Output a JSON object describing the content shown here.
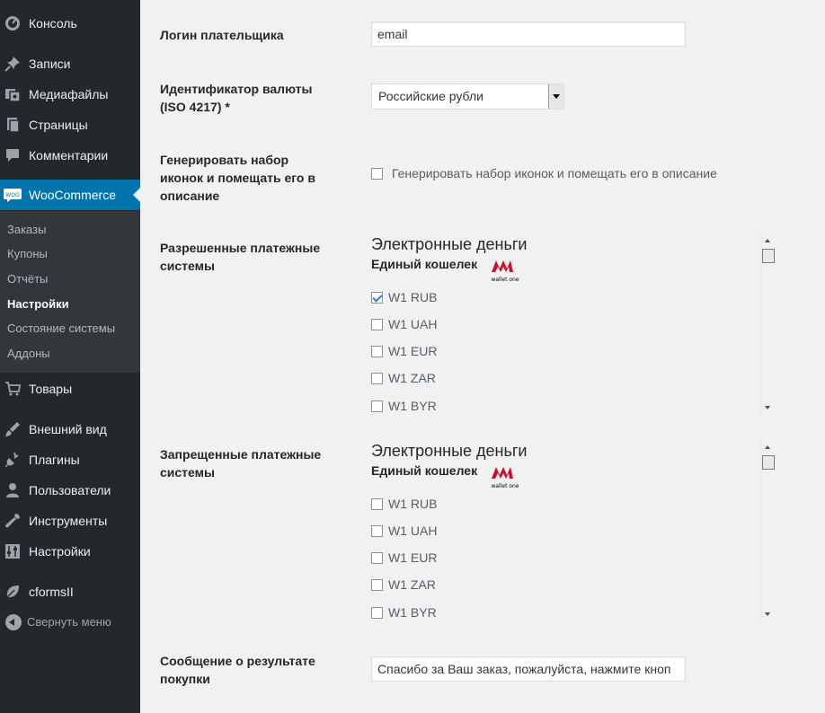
{
  "sidebar": {
    "menu": [
      {
        "label": "Консоль",
        "icon": "dashboard-icon"
      },
      {
        "label": "Записи",
        "icon": "pin-icon"
      },
      {
        "label": "Медиафайлы",
        "icon": "media-icon"
      },
      {
        "label": "Страницы",
        "icon": "pages-icon"
      },
      {
        "label": "Комментарии",
        "icon": "comment-icon"
      },
      {
        "label": "WooCommerce",
        "icon": "woo-icon"
      },
      {
        "label": "Товары",
        "icon": "cart-icon"
      },
      {
        "label": "Внешний вид",
        "icon": "brush-icon"
      },
      {
        "label": "Плагины",
        "icon": "plugin-icon"
      },
      {
        "label": "Пользователи",
        "icon": "user-icon"
      },
      {
        "label": "Инструменты",
        "icon": "wrench-icon"
      },
      {
        "label": "Настройки",
        "icon": "settings-icon"
      },
      {
        "label": "cformsII",
        "icon": "leaf-icon"
      }
    ],
    "woo_icon_text": "WOO",
    "submenu": [
      "Заказы",
      "Купоны",
      "Отчёты",
      "Настройки",
      "Состояние системы",
      "Аддоны"
    ],
    "collapse_label": "Свернуть меню"
  },
  "form": {
    "login": {
      "label": "Логин плательщика",
      "value": "email"
    },
    "currency": {
      "label_line1": "Идентификатор валюты",
      "label_line2": "(ISO 4217) *",
      "selected": "Российские рубли"
    },
    "icons": {
      "label_line1": "Генерировать набор",
      "label_line2": "иконок и помещать его в",
      "label_line3": "описание",
      "checkbox_label": "Генерировать набор иконок и помещать его в описание",
      "checked": false
    },
    "allowed": {
      "label_line1": "Разрешенные платежные",
      "label_line2": "системы",
      "group_title": "Электронные деньги",
      "group_sub": "Единый кошелек",
      "logo_text": "wallet one",
      "items": [
        {
          "label": "W1 RUB",
          "checked": true
        },
        {
          "label": "W1 UAH",
          "checked": false
        },
        {
          "label": "W1 EUR",
          "checked": false
        },
        {
          "label": "W1 ZAR",
          "checked": false
        },
        {
          "label": "W1 BYR",
          "checked": false
        }
      ]
    },
    "forbidden": {
      "label_line1": "Запрещенные платежные",
      "label_line2": "системы",
      "group_title": "Электронные деньги",
      "group_sub": "Единый кошелек",
      "logo_text": "wallet one",
      "items": [
        {
          "label": "W1 RUB",
          "checked": false
        },
        {
          "label": "W1 UAH",
          "checked": false
        },
        {
          "label": "W1 EUR",
          "checked": false
        },
        {
          "label": "W1 ZAR",
          "checked": false
        },
        {
          "label": "W1 BYR",
          "checked": false
        }
      ]
    },
    "result_message": {
      "label_line1": "Сообщение о результате",
      "label_line2": "покупки",
      "value": "Спасибо за Ваш заказ, пожалуйста, нажмите кноп"
    }
  },
  "colors": {
    "sidebar_bg": "#23282d",
    "submenu_bg": "#32373c",
    "active_bg": "#0073aa",
    "logo_red": "#c8102e",
    "page_bg": "#f1f1f1"
  }
}
